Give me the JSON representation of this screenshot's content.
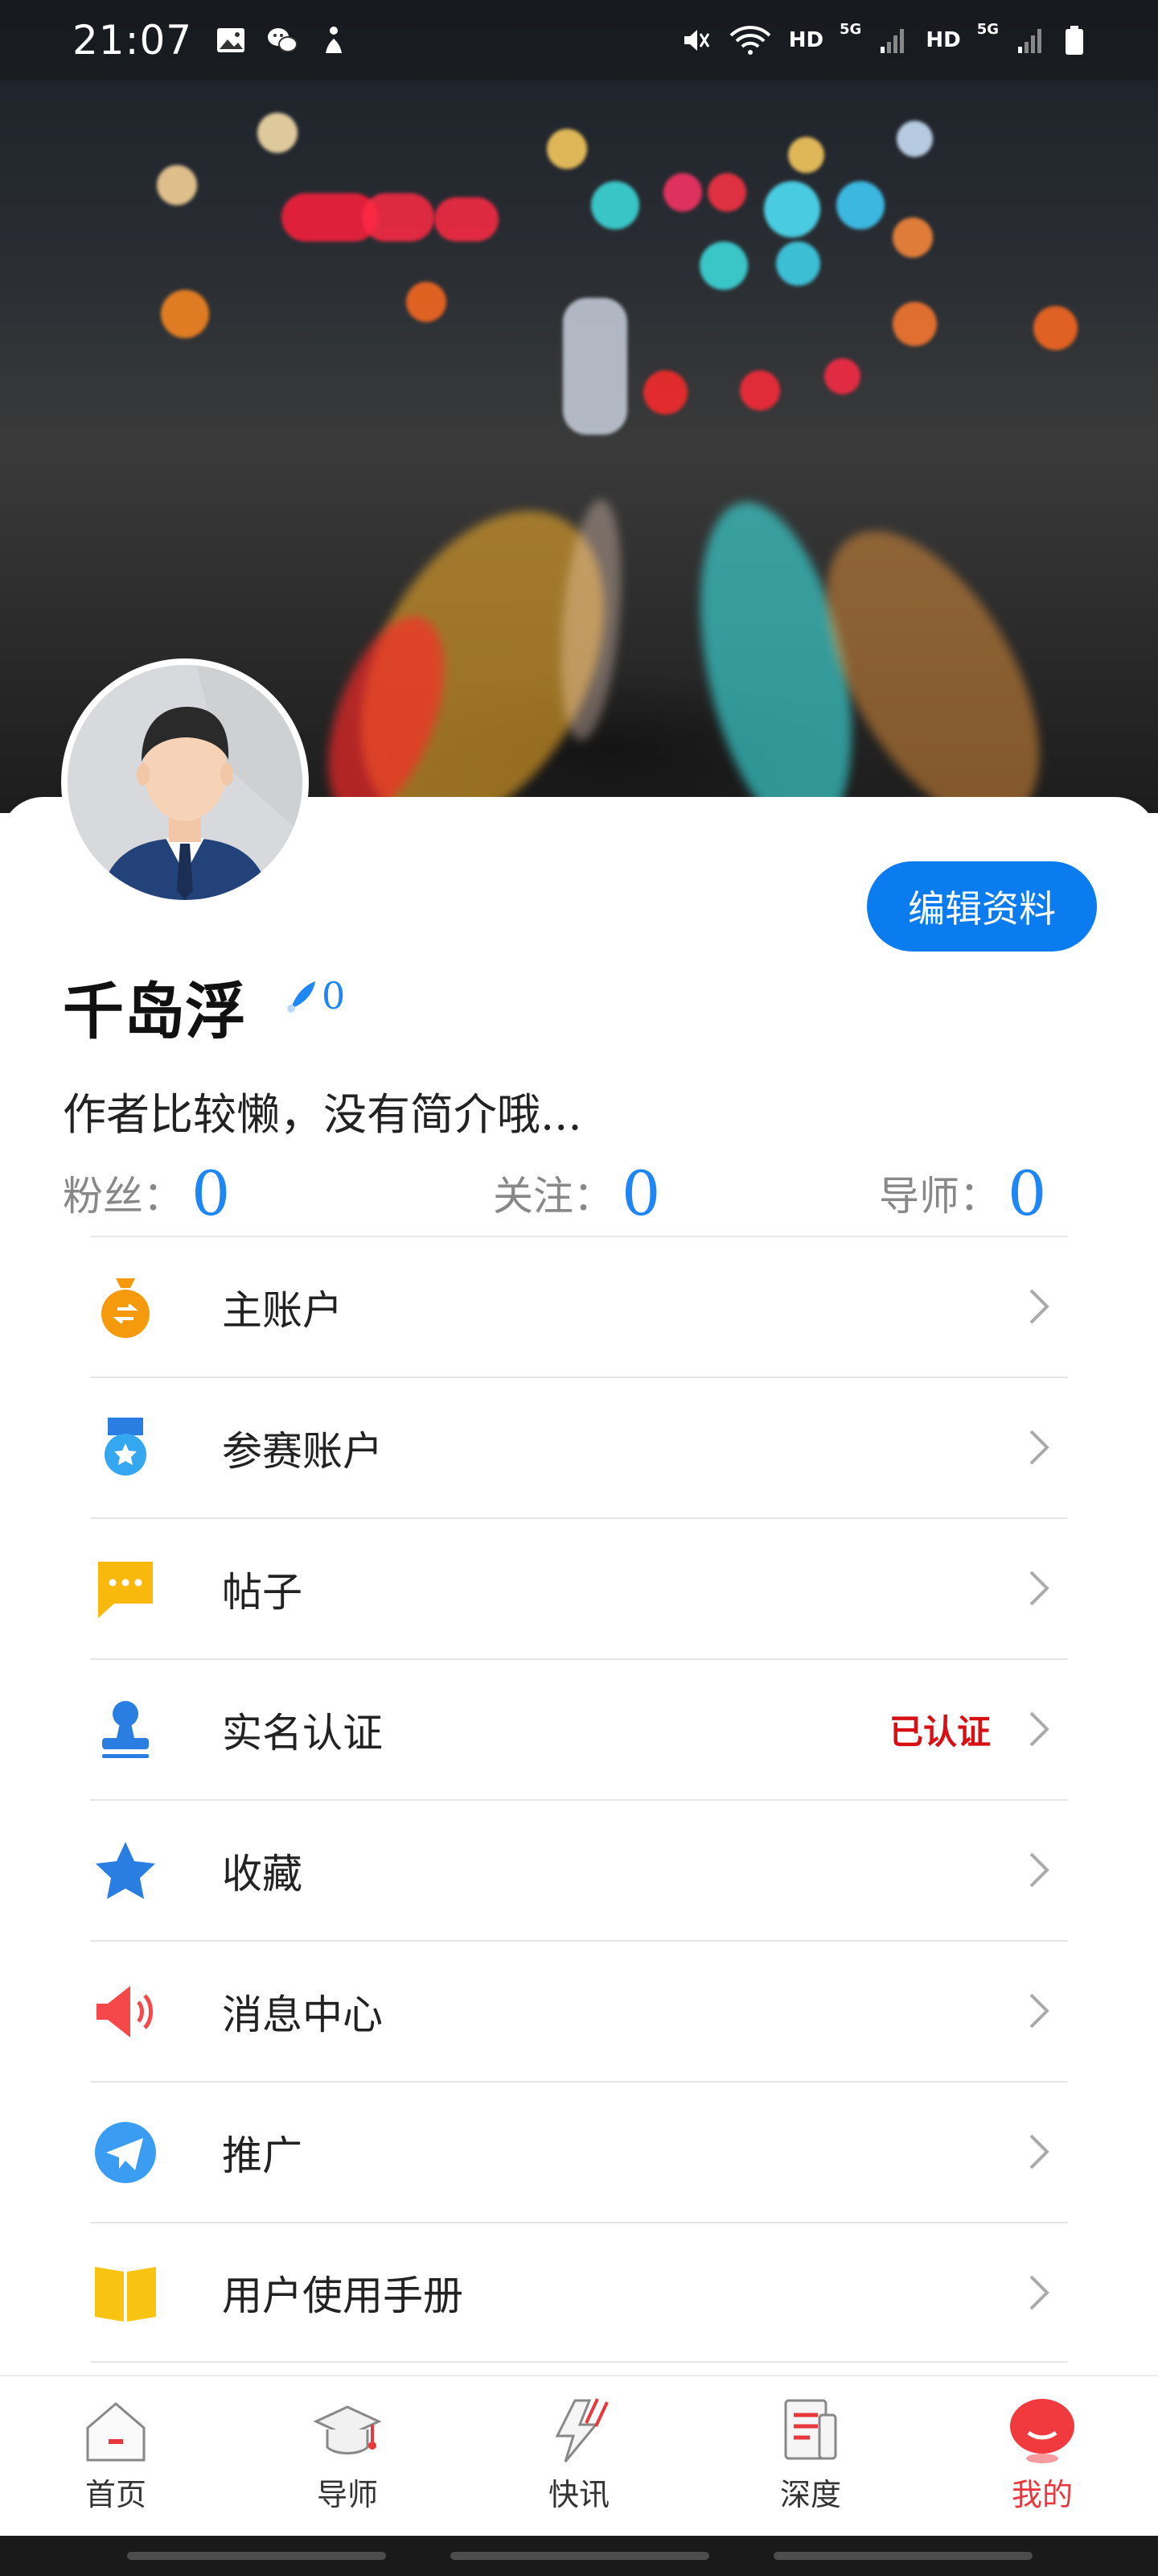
{
  "status_bar": {
    "time": "21:07",
    "network_labels": [
      "HD",
      "5G",
      "HD",
      "5G"
    ],
    "icons_left": [
      "image-icon",
      "wechat-icon",
      "figure-icon"
    ],
    "icons_right": [
      "mute-icon",
      "wifi-icon",
      "signal-icon",
      "signal-icon",
      "battery-icon"
    ]
  },
  "profile": {
    "nickname": "千岛浮",
    "level_value": "0",
    "bio": "作者比较懒，没有简介哦...",
    "edit_button": "编辑资料",
    "stats": [
      {
        "label": "粉丝：",
        "value": "0"
      },
      {
        "label": "关注：",
        "value": "0"
      },
      {
        "label": "导师：",
        "value": "0"
      }
    ]
  },
  "menu": [
    {
      "label": "主账户",
      "icon": "money-bag-icon",
      "badge": ""
    },
    {
      "label": "参赛账户",
      "icon": "medal-icon",
      "badge": ""
    },
    {
      "label": "帖子",
      "icon": "chat-bubble-icon",
      "badge": ""
    },
    {
      "label": "实名认证",
      "icon": "stamp-icon",
      "badge": "已认证"
    },
    {
      "label": "收藏",
      "icon": "star-icon",
      "badge": ""
    },
    {
      "label": "消息中心",
      "icon": "speaker-icon",
      "badge": ""
    },
    {
      "label": "推广",
      "icon": "paper-plane-icon",
      "badge": ""
    },
    {
      "label": "用户使用手册",
      "icon": "book-icon",
      "badge": ""
    }
  ],
  "bottom_nav": [
    {
      "label": "首页",
      "icon": "home-icon",
      "active": false
    },
    {
      "label": "导师",
      "icon": "graduation-cap-icon",
      "active": false
    },
    {
      "label": "快讯",
      "icon": "lightning-icon",
      "active": false
    },
    {
      "label": "深度",
      "icon": "document-icon",
      "active": false
    },
    {
      "label": "我的",
      "icon": "profile-face-icon",
      "active": true
    }
  ],
  "colors": {
    "accent_blue": "#0a7cf0",
    "stat_blue": "#1f86f5",
    "badge_red": "#d90f16",
    "active_nav_red": "#e8383d"
  }
}
